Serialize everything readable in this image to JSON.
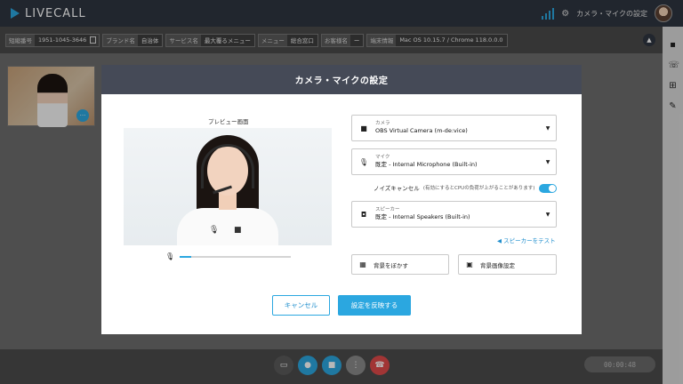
{
  "app": {
    "logo_text": "LIVECALL"
  },
  "topbar": {
    "settings_label": "カメラ・マイクの設定"
  },
  "infobar": {
    "tags": [
      {
        "key": "短縮番号",
        "value": "1951-1045-3646"
      },
      {
        "key": "ブランド名",
        "value": "自治体"
      },
      {
        "key": "サービス名",
        "value": "最大覆るメニュー"
      },
      {
        "key": "メニュー",
        "value": "総合窓口"
      },
      {
        "key": "お客様名",
        "value": "ー"
      },
      {
        "key": "端末情報",
        "value": "Mac OS 10.15.7 / Chrome 118.0.0.0"
      }
    ]
  },
  "call": {
    "timer": "00:00:48"
  },
  "modal": {
    "title": "カメラ・マイクの設定",
    "preview_title": "プレビュー画面",
    "mic_level": 0.1,
    "camera": {
      "label": "カメラ",
      "value": "OBS Virtual Camera (m-de:vice)"
    },
    "mic": {
      "label": "マイク",
      "value": "既定 - Internal Microphone (Built-in)"
    },
    "noise": {
      "label": "ノイズキャンセル",
      "note": "(有効にするとCPUの負荷が上がることがあります)",
      "enabled": true
    },
    "speaker": {
      "label": "スピーカー",
      "value": "既定 - Internal Speakers (Built-in)"
    },
    "speaker_test": "◀ スピーカーをテスト",
    "blur_label": "背景をぼかす",
    "bg_image_label": "背景画像設定",
    "cancel_label": "キャンセル",
    "apply_label": "設定を反映する"
  },
  "colors": {
    "accent": "#2ba7e0",
    "header": "#454a57",
    "topbar": "#2f3540"
  },
  "icons": [
    "signal-icon",
    "gear-icon",
    "copy-icon",
    "chevron-up-icon",
    "chat-icon",
    "phone-icon",
    "cart-icon",
    "pen-icon",
    "camera-icon",
    "microphone-icon",
    "speaker-icon",
    "blur-icon",
    "image-icon",
    "more-icon",
    "screen-share-icon",
    "hangup-icon"
  ]
}
